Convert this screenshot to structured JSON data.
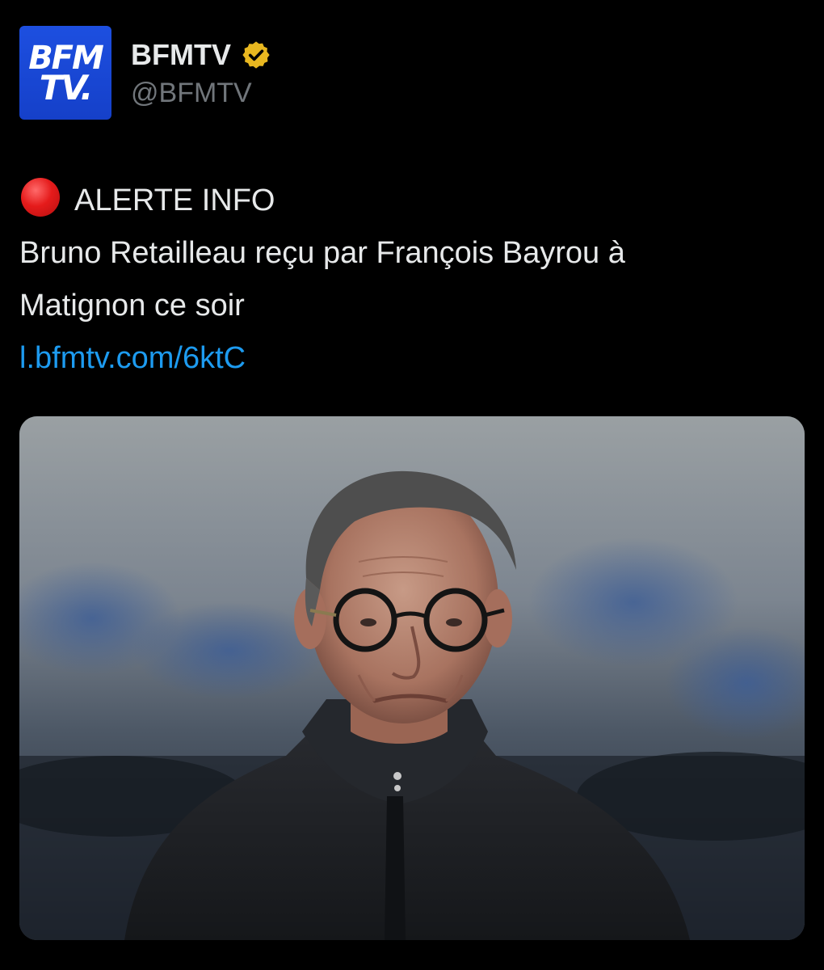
{
  "account": {
    "avatar_text_line1": "BFM",
    "avatar_text_line2": "TV.",
    "display_name": "BFMTV",
    "handle": "@BFMTV",
    "verified_icon": "verified-badge-gold",
    "avatar_color": "#1d4fe0",
    "verified_color": "#e8b720"
  },
  "tweet": {
    "alert_icon": "red-circle-emoji",
    "alert_label": "ALERTE INFO",
    "body_line1": "Bruno Retailleau reçu par François Bayrou à",
    "body_line2": "Matignon ce soir",
    "link": "l.bfmtv.com/6ktC",
    "link_color": "#1d9bf0"
  },
  "media": {
    "subject": "photo-man-glasses-dark-coat"
  }
}
